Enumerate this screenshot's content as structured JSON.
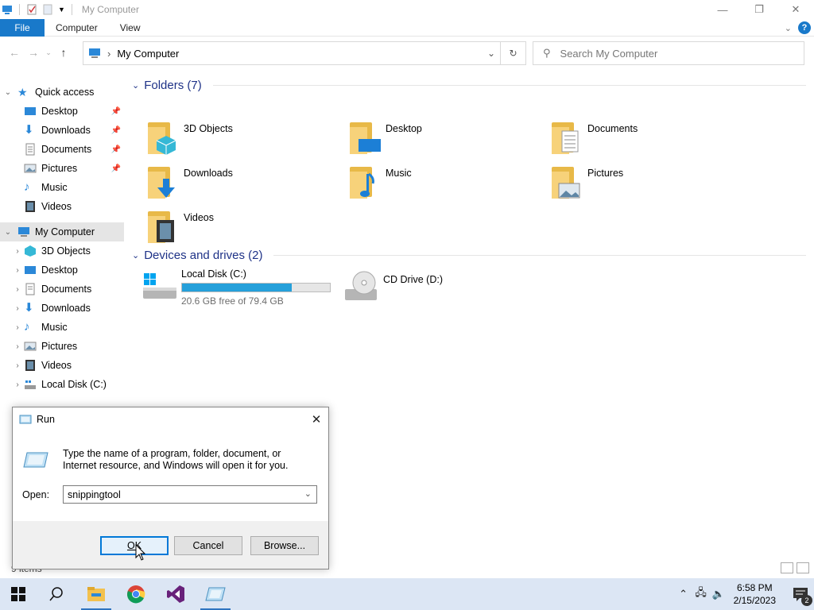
{
  "window": {
    "title": "My Computer",
    "controls": {
      "minimize": "—",
      "restore": "❐",
      "close": "✕"
    }
  },
  "ribbon": {
    "tabs": [
      "File",
      "Computer",
      "View"
    ]
  },
  "address": {
    "path": "My Computer",
    "search_placeholder": "Search My Computer"
  },
  "nav": {
    "quick_access": {
      "label": "Quick access",
      "items": [
        {
          "label": "Desktop",
          "icon": "desktop-icon",
          "pinned": true
        },
        {
          "label": "Downloads",
          "icon": "downloads-icon",
          "pinned": true
        },
        {
          "label": "Documents",
          "icon": "documents-icon",
          "pinned": true
        },
        {
          "label": "Pictures",
          "icon": "pictures-icon",
          "pinned": true
        },
        {
          "label": "Music",
          "icon": "music-icon",
          "pinned": false
        },
        {
          "label": "Videos",
          "icon": "videos-icon",
          "pinned": false
        }
      ]
    },
    "computer": {
      "label": "My Computer",
      "items": [
        {
          "label": "3D Objects",
          "icon": "3d-objects-icon"
        },
        {
          "label": "Desktop",
          "icon": "desktop-icon"
        },
        {
          "label": "Documents",
          "icon": "documents-icon"
        },
        {
          "label": "Downloads",
          "icon": "downloads-icon"
        },
        {
          "label": "Music",
          "icon": "music-icon"
        },
        {
          "label": "Pictures",
          "icon": "pictures-icon"
        },
        {
          "label": "Videos",
          "icon": "videos-icon"
        },
        {
          "label": "Local Disk (C:)",
          "icon": "local-disk-icon"
        }
      ]
    }
  },
  "content": {
    "folders_header": "Folders (7)",
    "folders": [
      "3D Objects",
      "Desktop",
      "Documents",
      "Downloads",
      "Music",
      "Pictures",
      "Videos"
    ],
    "drives_header": "Devices and drives (2)",
    "drives": [
      {
        "name": "Local Disk (C:)",
        "free_text": "20.6 GB free of 79.4 GB",
        "used_fraction": 0.74
      },
      {
        "name": "CD Drive (D:)"
      }
    ]
  },
  "status": {
    "items": "9 items"
  },
  "run_dialog": {
    "title": "Run",
    "description": "Type the name of a program, folder, document, or Internet resource, and Windows will open it for you.",
    "open_label": "Open:",
    "value": "snippingtool",
    "buttons": {
      "ok": "OK",
      "cancel": "Cancel",
      "browse": "Browse..."
    }
  },
  "taskbar": {
    "time": "6:58 PM",
    "date": "2/15/2023",
    "notification_count": "2",
    "apps": [
      "file-explorer-icon",
      "chrome-icon",
      "visual-studio-icon",
      "run-icon"
    ]
  },
  "colors": {
    "accent": "#1979ca",
    "folder": "#f7d27a",
    "drive_bar": "#26a0da",
    "taskbar": "#dce6f4"
  }
}
